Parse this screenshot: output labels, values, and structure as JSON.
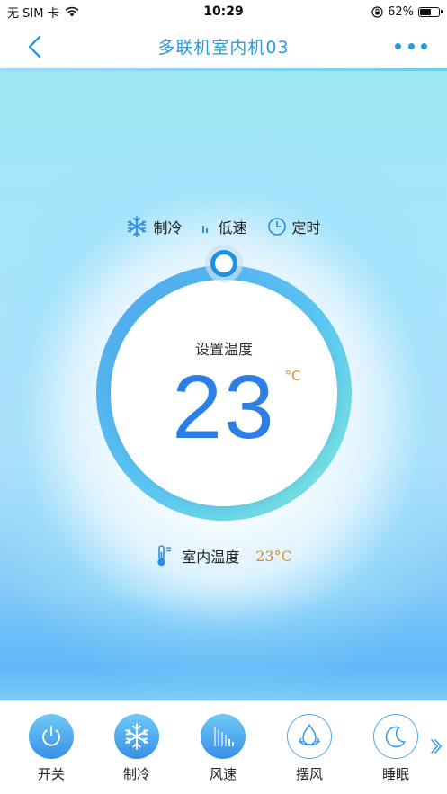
{
  "status_bar": {
    "carrier": "无 SIM 卡",
    "time": "10:29",
    "battery": "62%",
    "battery_level": 0.62
  },
  "nav": {
    "title": "多联机室内机03"
  },
  "modes": {
    "mode_label": "制冷",
    "fan_label": "低速",
    "timer_label": "定时"
  },
  "dial": {
    "set_label": "设置温度",
    "set_value": "23",
    "unit": "°C"
  },
  "indoor": {
    "label": "室内温度",
    "value": "23°C"
  },
  "controls": [
    {
      "label": "开关",
      "icon": "power-icon"
    },
    {
      "label": "制冷",
      "icon": "snowflake-icon"
    },
    {
      "label": "风速",
      "icon": "fan-speed-icon"
    },
    {
      "label": "摆风",
      "icon": "swing-icon"
    },
    {
      "label": "睡眠",
      "icon": "moon-icon"
    }
  ],
  "colors": {
    "accent": "#2a9ad8",
    "temperature": "#2d7fe8",
    "unit": "#e0902a"
  }
}
